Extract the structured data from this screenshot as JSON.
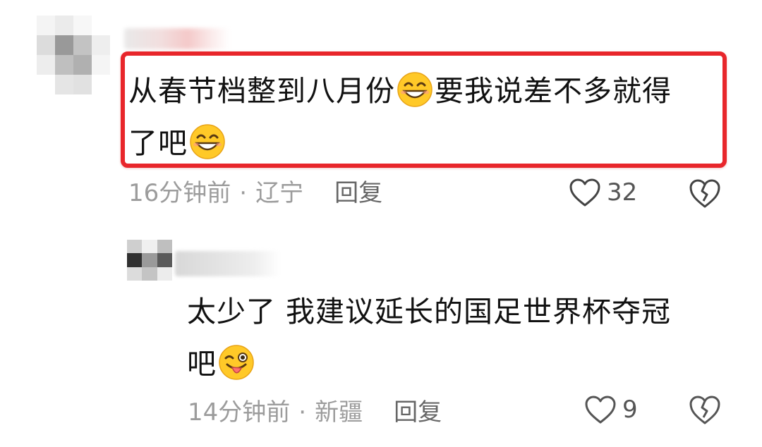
{
  "comments": [
    {
      "text_line_1": "从春节档整到八月份",
      "text_line_1b": "要我说差不多就得",
      "text_line_2": "了吧",
      "emoji": "grinning-face-icon",
      "time": "16分钟前",
      "separator": "·",
      "location": "辽宁",
      "reply_label": "回复",
      "like_count": "32",
      "highlighted": true
    },
    {
      "text_line_1": "太少了 我建议延长的国足世界杯夺冠",
      "text_line_2": "吧",
      "emoji": "winking-tongue-face-icon",
      "time": "14分钟前",
      "separator": "·",
      "location": "新疆",
      "reply_label": "回复",
      "like_count": "9"
    }
  ],
  "colors": {
    "highlight_border": "#e8262b",
    "meta_text": "#9c9c9c",
    "body_text": "#111111",
    "emoji_face": "#ffc928"
  }
}
